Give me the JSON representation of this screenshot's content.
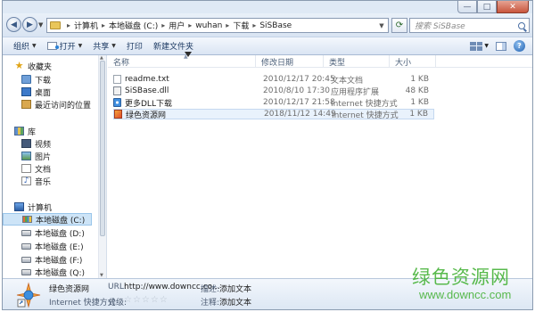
{
  "window": {
    "caption_buttons": {
      "minimize": "—",
      "maximize": "□",
      "close": "✕"
    }
  },
  "address": {
    "breadcrumbs": [
      "计算机",
      "本地磁盘 (C:)",
      "用户",
      "wuhan",
      "下载",
      "SiSBase"
    ],
    "search_placeholder": "搜索 SiSBase"
  },
  "toolbar": {
    "organize": "组织",
    "open": "打开",
    "share": "共享",
    "print": "打印",
    "new_folder": "新建文件夹"
  },
  "nav": {
    "favorites": "收藏夹",
    "favorites_items": [
      "下载",
      "桌面",
      "最近访问的位置"
    ],
    "libraries": "库",
    "libraries_items": [
      "视频",
      "图片",
      "文档",
      "音乐"
    ],
    "computer": "计算机",
    "drives": [
      "本地磁盘 (C:)",
      "本地磁盘 (D:)",
      "本地磁盘 (E:)",
      "本地磁盘 (F:)",
      "本地磁盘 (Q:)"
    ]
  },
  "columns": {
    "name": "名称",
    "modified": "修改日期",
    "type": "类型",
    "size": "大小"
  },
  "files": [
    {
      "name": "readme.txt",
      "modified": "2010/12/17 20:45",
      "type": "文本文档",
      "size": "1 KB",
      "icon": "text-file-icon"
    },
    {
      "name": "SiSBase.dll",
      "modified": "2010/8/10 17:30",
      "type": "应用程序扩展",
      "size": "48 KB",
      "icon": "dll-file-icon"
    },
    {
      "name": "更多DLL下载",
      "modified": "2010/12/17 21:58",
      "type": "Internet 快捷方式",
      "size": "1 KB",
      "icon": "internet-shortcut-icon"
    },
    {
      "name": "绿色资源网",
      "modified": "2018/11/12 14:49",
      "type": "Internet 快捷方式",
      "size": "1 KB",
      "icon": "internet-shortcut-icon"
    }
  ],
  "details": {
    "name": "绿色资源网",
    "type": "Internet 快捷方式",
    "url_label": "URL:",
    "url_value": "http://www.downcc.co...",
    "rating_label": "分级:",
    "stars": "☆☆☆☆☆",
    "desc_label": "描述:",
    "desc_value": "添加文本",
    "note_label": "注释:",
    "note_value": "添加文本"
  },
  "watermark": {
    "title": "绿色资源网",
    "url": "www.downcc.com"
  }
}
